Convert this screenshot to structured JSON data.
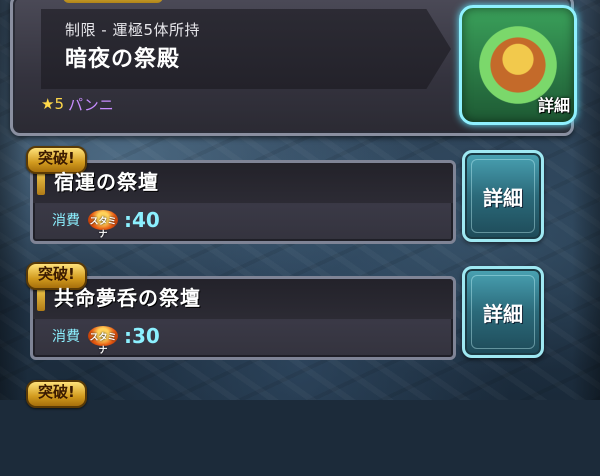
{
  "top_card": {
    "restriction": "制限 - 運極5体所持",
    "title": "暗夜の祭殿",
    "sub_star": "★5",
    "sub_name": "パンニ",
    "detail_label": "詳細"
  },
  "quests": [
    {
      "tag": "突破!",
      "name": "宿運の祭壇",
      "cost_label": "消費",
      "stamina_label": "スタミナ",
      "cost_value": ":40",
      "detail_label": "詳細"
    },
    {
      "tag": "突破!",
      "name": "共命夢呑の祭壇",
      "cost_label": "消費",
      "stamina_label": "スタミナ",
      "cost_value": ":30",
      "detail_label": "詳細"
    },
    {
      "tag": "突破!"
    }
  ],
  "colors": {
    "accent_gold": "#f2c94c",
    "button_teal": "#2b6a7a",
    "cost_cyan": "#8cf0ff",
    "star_name_purple": "#c78cff"
  }
}
